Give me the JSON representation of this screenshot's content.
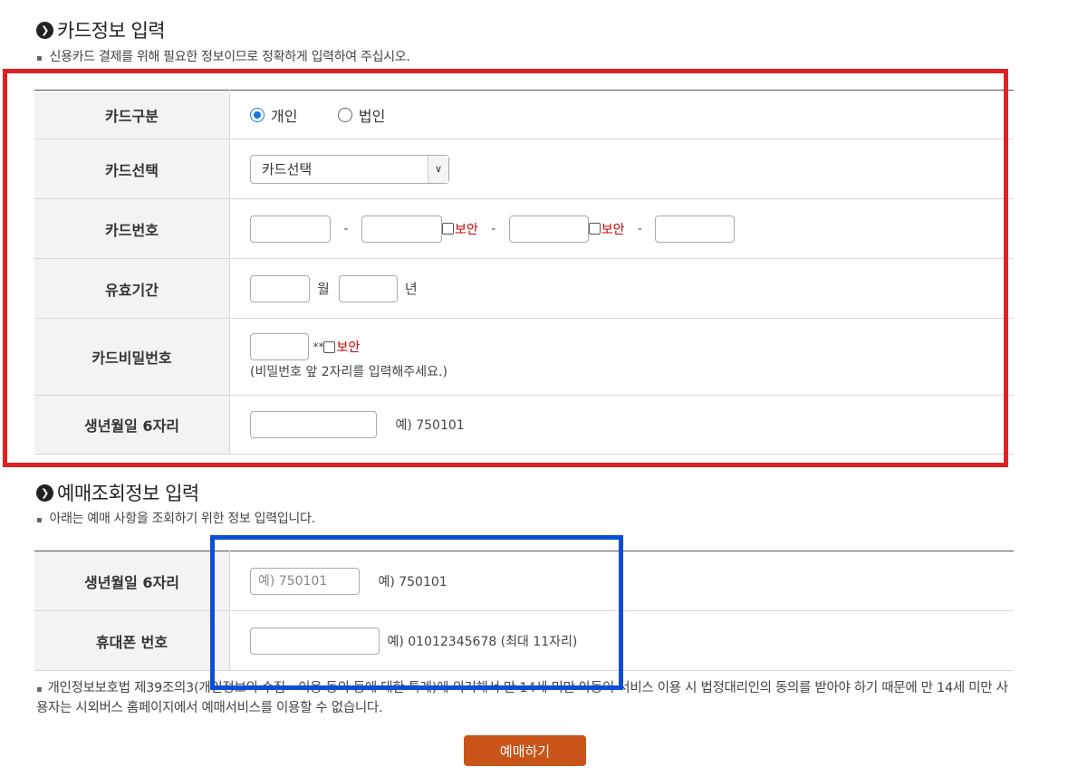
{
  "card_section": {
    "title": "카드정보 입력",
    "desc": "신용카드 결제를 위해 필요한 정보이므로 정확하게 입력하여 주십시오.",
    "rows": {
      "card_type": {
        "label": "카드구분",
        "options": [
          "개인",
          "법인"
        ],
        "selected": "개인"
      },
      "card_select": {
        "label": "카드선택",
        "value": "카드선택"
      },
      "card_number": {
        "label": "카드번호",
        "dash": "-",
        "secure_label": "보안"
      },
      "expiry": {
        "label": "유효기간",
        "month_unit": "월",
        "year_unit": "년"
      },
      "card_password": {
        "label": "카드비밀번호",
        "mask": "**",
        "secure_label": "보안",
        "hint": "(비밀번호 앞 2자리를 입력해주세요.)"
      },
      "birth": {
        "label": "생년월일 6자리",
        "example": "예) 750101"
      }
    }
  },
  "lookup_section": {
    "title": "예매조회정보 입력",
    "desc": "아래는 예매 사항을 조회하기 위한 정보 입력입니다.",
    "rows": {
      "birth": {
        "label": "생년월일 6자리",
        "placeholder": "예) 750101",
        "example": "예) 750101"
      },
      "phone": {
        "label": "휴대폰 번호",
        "example": "예) 01012345678 (최대 11자리)"
      }
    }
  },
  "notice": "개인정보보호법 제39조의3(개인정보의 수집・이용 동의 등에 대한 특례)에 의거해서 만 14세 미만 아동이 서비스 이용 시 법정대리인의 동의를 받아야 하기 때문에 만 14세 미만 사용자는 시외버스 홈페이지에서 예매서비스를 이용할 수 없습니다.",
  "submit_button": "예매하기",
  "colors": {
    "highlight_red": "#e02020",
    "highlight_blue": "#0b4fd8",
    "button_bg": "#c8541a",
    "radio_selected": "#1a73e8",
    "secure_text": "#cc0000"
  }
}
